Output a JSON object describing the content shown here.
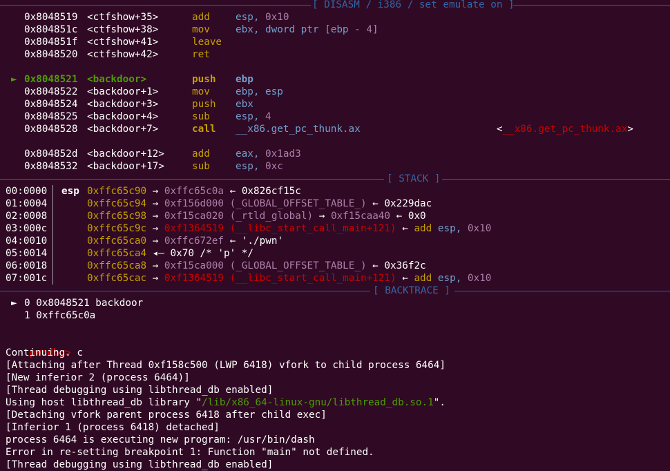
{
  "colors": {
    "background": "#300a24",
    "rule": "#2b5fa6",
    "accent_green": "#4e9a06",
    "accent_red": "#cc0000",
    "accent_yellow": "#c4a000",
    "accent_blue": "#729fcf",
    "accent_purple": "#ad7fa8"
  },
  "disasm": {
    "header": "[ DISASM / i386 / set emulate on ]",
    "lines": [
      {
        "marker": "",
        "addr": "0x8048519",
        "sym": "<ctfshow+35>",
        "mnem": "add",
        "ops": "esp, ",
        "opnum": "0x10"
      },
      {
        "marker": "",
        "addr": "0x804851c",
        "sym": "<ctfshow+38>",
        "mnem": "mov",
        "ops": "ebx, dword ptr [ebp - ",
        "opnum": "4",
        "ops_tail": "]"
      },
      {
        "marker": "",
        "addr": "0x804851f",
        "sym": "<ctfshow+41>",
        "mnem": "leave",
        "ops": "",
        "opnum": ""
      },
      {
        "marker": "",
        "addr": "0x8048520",
        "sym": "<ctfshow+42>",
        "mnem": "ret",
        "ops": "",
        "opnum": ""
      },
      {
        "marker": "►",
        "addr": "0x8048521",
        "sym": "<backdoor>",
        "mnem": "push",
        "ops": "ebp",
        "opnum": ""
      },
      {
        "marker": "",
        "addr": "0x8048522",
        "sym": "<backdoor+1>",
        "mnem": "mov",
        "ops": "ebp, esp",
        "opnum": ""
      },
      {
        "marker": "",
        "addr": "0x8048524",
        "sym": "<backdoor+3>",
        "mnem": "push",
        "ops": "ebx",
        "opnum": ""
      },
      {
        "marker": "",
        "addr": "0x8048525",
        "sym": "<backdoor+4>",
        "mnem": "sub",
        "ops": "esp, ",
        "opnum": "4"
      },
      {
        "marker": "",
        "addr": "0x8048528",
        "sym": "<backdoor+7>",
        "mnem": "call",
        "ops": "__x86.get_pc_thunk.ax",
        "opnum": "",
        "target": "__x86.get_pc_thunk.ax"
      },
      {
        "marker": "",
        "addr": "0x804852d",
        "sym": "<backdoor+12>",
        "mnem": "add",
        "ops": "eax, ",
        "opnum": "0x1ad3"
      },
      {
        "marker": "",
        "addr": "0x8048532",
        "sym": "<backdoor+17>",
        "mnem": "sub",
        "ops": "esp, ",
        "opnum": "0xc"
      }
    ]
  },
  "stack": {
    "header": "[ STACK ]",
    "rows": [
      {
        "off": "00:0000",
        "reg": "esp",
        "addr": "0xffc65c90",
        "p1": "0xffc65c0a",
        "p1s": "",
        "p2": "0x826cf15c",
        "p2s": "",
        "tail": ""
      },
      {
        "off": "01:0004",
        "reg": "",
        "addr": "0xffc65c94",
        "p1": "0xf156d000",
        "p1s": "(_GLOBAL_OFFSET_TABLE_)",
        "p2": "0x229dac",
        "p2s": "",
        "tail": ""
      },
      {
        "off": "02:0008",
        "reg": "",
        "addr": "0xffc65c98",
        "p1": "0xf15ca020",
        "p1s": "(_rtld_global)",
        "p2": "0xf15caa40",
        "p2s": "",
        "p3": "0x0"
      },
      {
        "off": "03:000c",
        "reg": "",
        "addr": "0xffc65c9c",
        "p1": "0xf1364519",
        "p1s": "(__libc_start_call_main+121)",
        "p2": "",
        "p2s": "",
        "insn_m": "add",
        "insn_o": "esp, ",
        "insn_n": "0x10"
      },
      {
        "off": "04:0010",
        "reg": "",
        "addr": "0xffc65ca0",
        "p1": "0xffc672ef",
        "p1s": "",
        "p2": "'./pwn'",
        "p2s": "",
        "tail": ""
      },
      {
        "off": "05:0014",
        "reg": "",
        "addr": "0xffc65ca4",
        "p1": "",
        "p1s": "",
        "p2": "0x70 /* 'p' */",
        "p2s": "",
        "tail": ""
      },
      {
        "off": "06:0018",
        "reg": "",
        "addr": "0xffc65ca8",
        "p1": "0xf15ca000",
        "p1s": "(_GLOBAL_OFFSET_TABLE_)",
        "p2": "0x36f2c",
        "p2s": "",
        "tail": ""
      },
      {
        "off": "07:001c",
        "reg": "",
        "addr": "0xffc65cac",
        "p1": "0xf1364519",
        "p1s": "(__libc_start_call_main+121)",
        "p2": "",
        "p2s": "",
        "insn_m": "add",
        "insn_o": "esp, ",
        "insn_n": "0x10"
      }
    ]
  },
  "backtrace": {
    "header": "[ BACKTRACE ]",
    "frames": [
      {
        "marker": "►",
        "idx": "0",
        "addr": "0x8048521",
        "name": "backdoor"
      },
      {
        "marker": "",
        "idx": "1",
        "addr": "0xffc65c0a",
        "name": ""
      }
    ]
  },
  "console": {
    "prompt": "pwndbg>",
    "command": "c",
    "lines": [
      "Continuing.",
      "[Attaching after Thread 0xf158c500 (LWP 6418) vfork to child process 6464]",
      "[New inferior 2 (process 6464)]",
      "[Thread debugging using libthread_db enabled]",
      "Using host libthread_db library \"/lib/x86_64-linux-gnu/libthread_db.so.1\".",
      "[Detaching vfork parent process 6418 after child exec]",
      "[Inferior 1 (process 6418) detached]",
      "process 6464 is executing new program: /usr/bin/dash",
      "Error in re-setting breakpoint 1: Function \"main\" not defined.",
      "[Thread debugging using libthread_db enabled]"
    ]
  }
}
